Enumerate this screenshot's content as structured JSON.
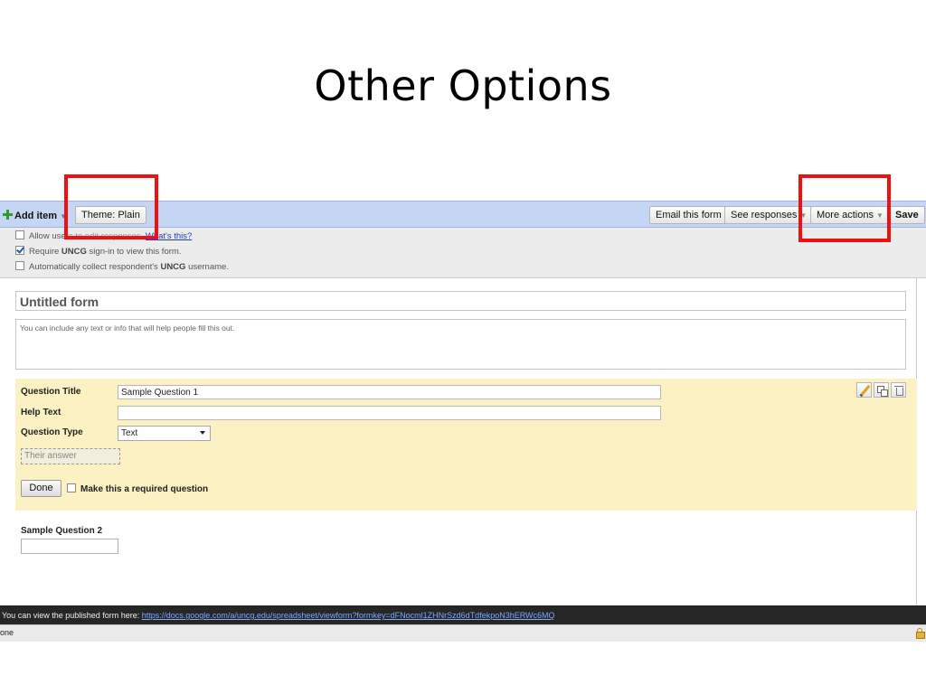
{
  "slide": {
    "title": "Other Options"
  },
  "toolbar": {
    "add_item": "Add item",
    "theme": "Theme: Plain",
    "email_form": "Email this form",
    "see_responses": "See responses",
    "more_actions": "More actions",
    "save": "Save"
  },
  "options": {
    "allow_edit": {
      "prefix": "Allow use",
      "faded": "rs to edit responses.",
      "link": "What's this?",
      "checked": false
    },
    "require_signin": {
      "before": "Require ",
      "org": "UNCG",
      "after": " sign-in to view this form.",
      "checked": true
    },
    "collect_username": {
      "before": "Automatically collect respondent's ",
      "org": "UNCG",
      "after": " username.",
      "checked": false
    }
  },
  "form": {
    "title": "Untitled form",
    "description_placeholder": "You can include any text or info that will help people fill this out."
  },
  "question_editor": {
    "title_label": "Question Title",
    "title_value": "Sample Question 1",
    "help_label": "Help Text",
    "help_value": "",
    "type_label": "Question Type",
    "type_value": "Text",
    "answer_placeholder": "Their answer",
    "done": "Done",
    "required_label": "Make this a required question"
  },
  "question2": {
    "label": "Sample Question 2"
  },
  "status": {
    "published_text": "You can view the published form here: ",
    "published_url": "https://docs.google.com/a/uncg.edu/spreadsheet/viewform?formkey=dFNocml1ZHNrSzd6dTdfekpoN3hERWc6MQ",
    "browser_status": "one"
  },
  "colors": {
    "highlight": "#ee1111",
    "toolbar": "#c4d6f4",
    "question_panel": "#fbf1c2"
  }
}
